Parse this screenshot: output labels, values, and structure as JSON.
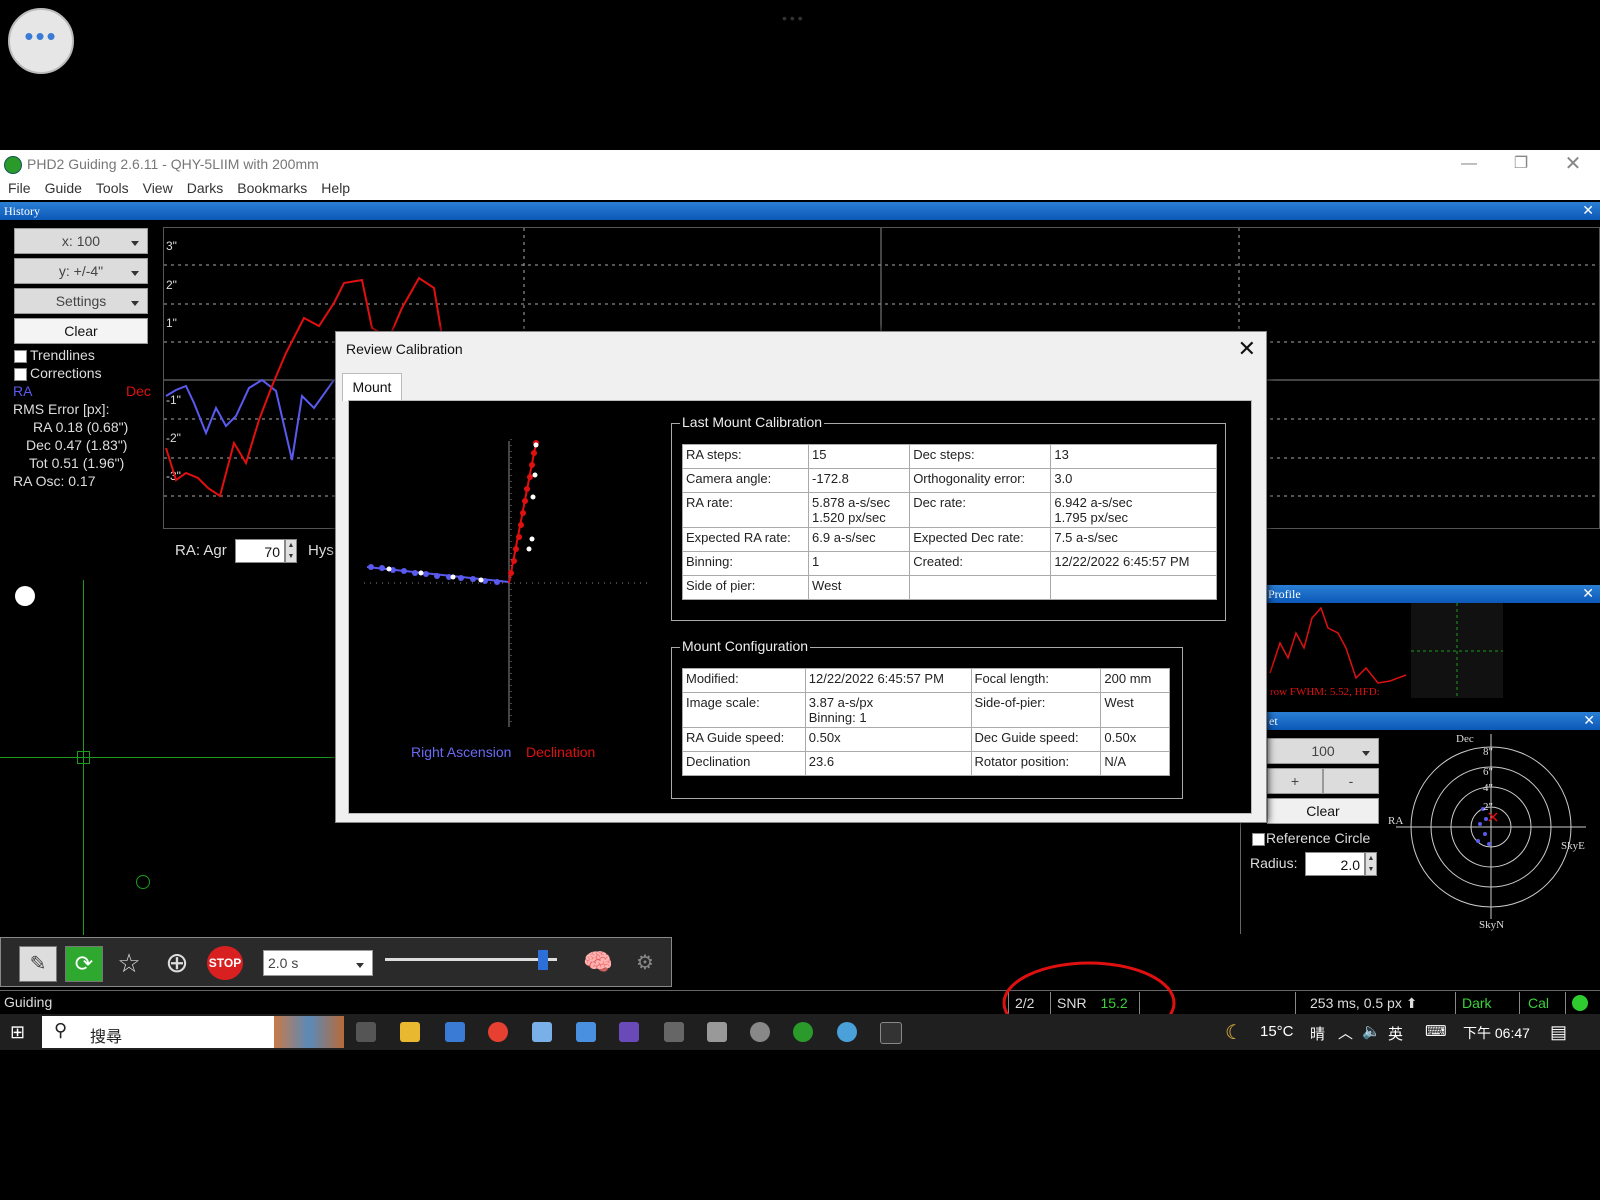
{
  "window": {
    "title": "PHD2 Guiding 2.6.11 - QHY-5LIIM with 200mm"
  },
  "menu": [
    "File",
    "Guide",
    "Tools",
    "View",
    "Darks",
    "Bookmarks",
    "Help"
  ],
  "history": {
    "header": "History",
    "x_scale": "x: 100",
    "y_scale": "y: +/-4\"",
    "settings": "Settings",
    "clear": "Clear",
    "trendlines": "Trendlines",
    "corrections": "Corrections",
    "ra_label": "RA",
    "dec_label": "Dec",
    "rms_title": "RMS Error [px]:",
    "rms_ra": "RA 0.18 (0.68\")",
    "rms_dec": "Dec 0.47 (1.83\")",
    "rms_tot": "Tot 0.51 (1.96\")",
    "ra_osc": "RA Osc: 0.17",
    "y_ticks": [
      "3\"",
      "2\"",
      "1\"",
      "-1\"",
      "-2\"",
      "-3\""
    ],
    "ra_agr_label": "RA: Agr",
    "ra_agr_value": "70",
    "hys_label": "Hys",
    "colors": {
      "ra": "#5a5af0",
      "dec": "#e01010"
    }
  },
  "dialog": {
    "title": "Review Calibration",
    "tab": "Mount",
    "legend_ra": "Right Ascension",
    "legend_dec": "Declination",
    "last_cal": {
      "title": "Last Mount Calibration",
      "rows": [
        [
          "RA steps:",
          "15",
          "Dec steps:",
          "13"
        ],
        [
          "Camera angle:",
          "-172.8",
          "Orthogonality error:",
          "3.0"
        ],
        [
          "RA rate:",
          "5.878 a-s/sec\n1.520 px/sec",
          "Dec rate:",
          "6.942 a-s/sec\n1.795 px/sec"
        ],
        [
          "Expected RA rate:",
          "6.9 a-s/sec",
          "Expected Dec rate:",
          "7.5 a-s/sec"
        ],
        [
          "Binning:",
          "1",
          "Created:",
          "12/22/2022 6:45:57 PM"
        ],
        [
          "Side of pier:",
          "West",
          "",
          ""
        ]
      ]
    },
    "mount_cfg": {
      "title": "Mount Configuration",
      "rows": [
        [
          "Modified:",
          "12/22/2022 6:45:57 PM",
          "Focal length:",
          "200 mm"
        ],
        [
          "Image scale:",
          "3.87 a-s/px\nBinning: 1",
          "Side-of-pier:",
          "West"
        ],
        [
          "RA Guide speed:",
          "0.50x",
          "Dec Guide speed:",
          "0.50x"
        ],
        [
          "Declination",
          "23.6",
          "Rotator position:",
          "N/A"
        ]
      ]
    }
  },
  "profile": {
    "header": "Profile",
    "fwhm_text": "row FWHM: 5.52, HFD:"
  },
  "target": {
    "header": "et",
    "zoom": "100",
    "plus": "+",
    "minus": "-",
    "clear": "Clear",
    "ref_circle": "Reference Circle",
    "radius_label": "Radius:",
    "radius_value": "2.0",
    "dec_label": "Dec",
    "ra_label": "RA",
    "skye": "SkyE",
    "skyn": "SkyN",
    "rings": [
      "8\"",
      "6\"",
      "4\"",
      "2\""
    ]
  },
  "toolbar": {
    "exposure": "2.0 s"
  },
  "status": {
    "text": "Guiding",
    "frames": "2/2",
    "snr_label": "SNR",
    "snr_value": "15.2",
    "timing": "253 ms, 0.5 px",
    "dark": "Dark",
    "cal": "Cal"
  },
  "taskbar": {
    "search": "搜尋",
    "temp": "15°C",
    "weather": "晴",
    "ime": "英",
    "time": "下午 06:47"
  }
}
